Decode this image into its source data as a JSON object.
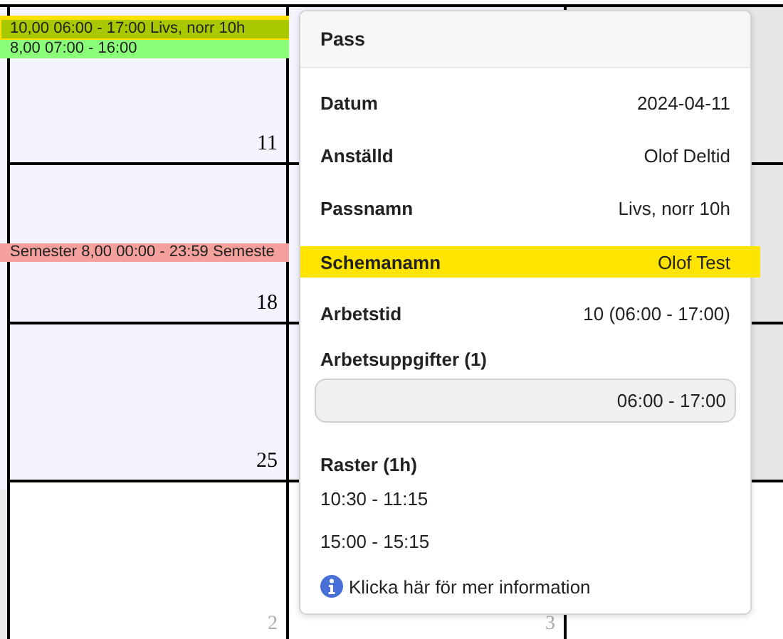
{
  "calendar": {
    "rows": [
      {
        "cells": [
          {
            "kind": "month",
            "day": "11",
            "outside_month": false,
            "events": [
              {
                "text": "10,00 06:00 - 17:00 Livs, norr 10h",
                "color": "#a9c800",
                "selected": true
              },
              {
                "text": "8,00 07:00 - 16:00",
                "color": "#8cff7a",
                "selected": false
              }
            ]
          },
          {
            "kind": "month"
          },
          {
            "kind": "gray"
          }
        ]
      },
      {
        "cells": [
          {
            "kind": "month",
            "day": "18",
            "outside_month": false,
            "events": [
              {
                "text": "Semester 8,00 00:00 - 23:59 Semeste",
                "color": "#f4a09c",
                "selected": false
              }
            ]
          },
          {
            "kind": "month"
          },
          {
            "kind": "gray"
          }
        ]
      },
      {
        "cells": [
          {
            "kind": "month",
            "day": "25",
            "outside_month": false
          },
          {
            "kind": "month"
          },
          {
            "kind": "gray"
          }
        ]
      },
      {
        "cells": [
          {
            "kind": "plain",
            "day": "2",
            "outside_month": true
          },
          {
            "kind": "plain",
            "day": "3",
            "outside_month": true
          },
          {
            "kind": "plain"
          }
        ]
      }
    ]
  },
  "popup": {
    "title": "Pass",
    "fields": [
      {
        "label": "Datum",
        "value": "2024-04-11",
        "highlighted": false
      },
      {
        "label": "Anställd",
        "value": "Olof Deltid",
        "highlighted": false
      },
      {
        "label": "Passnamn",
        "value": "Livs, norr 10h",
        "highlighted": false
      },
      {
        "label": "Schemanamn",
        "value": "Olof Test",
        "highlighted": true
      },
      {
        "label": "Arbetstid",
        "value": "10 (06:00 - 17:00)",
        "highlighted": false
      }
    ],
    "tasks": {
      "title": "Arbetsuppgifter (1)",
      "items": [
        "06:00 - 17:00"
      ]
    },
    "breaks": {
      "title": "Raster (1h)",
      "items": [
        "10:30 - 11:15",
        "15:00 - 15:15"
      ]
    },
    "info_link": "Klicka här för mer information"
  }
}
